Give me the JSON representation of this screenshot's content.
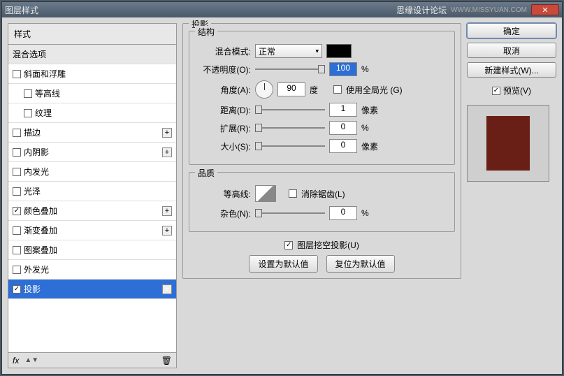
{
  "titlebar": {
    "title": "图层样式",
    "forum": "思缘设计论坛",
    "watermark": "WWW.MISSYUAN.COM"
  },
  "left": {
    "header": "样式",
    "blending": "混合选项",
    "items": [
      {
        "label": "斜面和浮雕",
        "checked": false,
        "plus": false,
        "indent": 0
      },
      {
        "label": "等高线",
        "checked": false,
        "plus": false,
        "indent": 1
      },
      {
        "label": "纹理",
        "checked": false,
        "plus": false,
        "indent": 1
      },
      {
        "label": "描边",
        "checked": false,
        "plus": true,
        "indent": 0
      },
      {
        "label": "内阴影",
        "checked": false,
        "plus": true,
        "indent": 0
      },
      {
        "label": "内发光",
        "checked": false,
        "plus": false,
        "indent": 0
      },
      {
        "label": "光泽",
        "checked": false,
        "plus": false,
        "indent": 0
      },
      {
        "label": "颜色叠加",
        "checked": true,
        "plus": true,
        "indent": 0
      },
      {
        "label": "渐变叠加",
        "checked": false,
        "plus": true,
        "indent": 0
      },
      {
        "label": "图案叠加",
        "checked": false,
        "plus": false,
        "indent": 0
      },
      {
        "label": "外发光",
        "checked": false,
        "plus": false,
        "indent": 0
      },
      {
        "label": "投影",
        "checked": true,
        "plus": true,
        "indent": 0,
        "selected": true
      }
    ],
    "footer_fx": "fx"
  },
  "center": {
    "panel_title": "投影",
    "structure": {
      "title": "结构",
      "blend_mode_label": "混合模式:",
      "blend_mode_value": "正常",
      "opacity_label": "不透明度(O):",
      "opacity_value": "100",
      "opacity_unit": "%",
      "angle_label": "角度(A):",
      "angle_value": "90",
      "angle_unit": "度",
      "global_light": "使用全局光 (G)",
      "distance_label": "距离(D):",
      "distance_value": "1",
      "distance_unit": "像素",
      "spread_label": "扩展(R):",
      "spread_value": "0",
      "spread_unit": "%",
      "size_label": "大小(S):",
      "size_value": "0",
      "size_unit": "像素"
    },
    "quality": {
      "title": "品质",
      "contour_label": "等高线:",
      "antialias": "消除锯齿(L)",
      "noise_label": "杂色(N):",
      "noise_value": "0",
      "noise_unit": "%"
    },
    "knockout": "图层挖空投影(U)",
    "btn_default": "设置为默认值",
    "btn_reset": "复位为默认值"
  },
  "right": {
    "ok": "确定",
    "cancel": "取消",
    "new_style": "新建样式(W)...",
    "preview": "预览(V)"
  }
}
